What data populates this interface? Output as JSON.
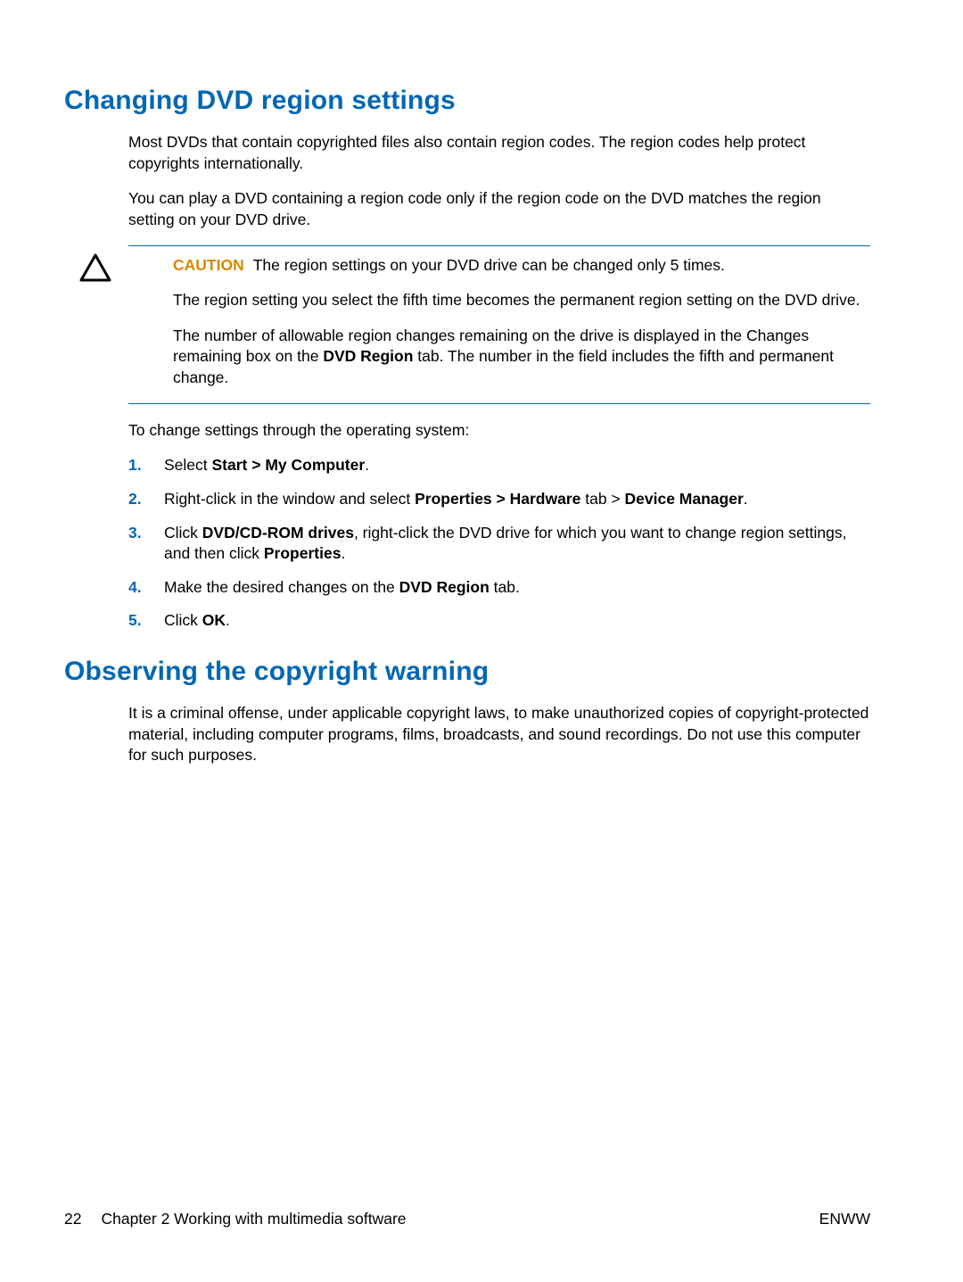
{
  "section1": {
    "heading": "Changing DVD region settings",
    "para1": "Most DVDs that contain copyrighted files also contain region codes. The region codes help protect copyrights internationally.",
    "para2": "You can play a DVD containing a region code only if the region code on the DVD matches the region setting on your DVD drive.",
    "caution": {
      "label": "CAUTION",
      "p1_tail": "The region settings on your DVD drive can be changed only 5 times.",
      "p2": "The region setting you select the fifth time becomes the permanent region setting on the DVD drive.",
      "p3_pre": "The number of allowable region changes remaining on the drive is displayed in the Changes remaining box on the ",
      "p3_bold": "DVD Region",
      "p3_post": " tab. The number in the field includes the fifth and permanent change."
    },
    "para3": "To change settings through the operating system:",
    "steps": {
      "s1_pre": "Select ",
      "s1_b": "Start > My Computer",
      "s1_post": ".",
      "s2_pre": "Right-click in the window and select ",
      "s2_b1": "Properties > Hardware",
      "s2_mid": " tab > ",
      "s2_b2": "Device Manager",
      "s2_post": ".",
      "s3_pre": "Click ",
      "s3_b1": "DVD/CD-ROM drives",
      "s3_mid": ", right-click the DVD drive for which you want to change region settings, and then click ",
      "s3_b2": "Properties",
      "s3_post": ".",
      "s4_pre": "Make the desired changes on the ",
      "s4_b": "DVD Region",
      "s4_post": " tab.",
      "s5_pre": "Click ",
      "s5_b": "OK",
      "s5_post": "."
    }
  },
  "section2": {
    "heading": "Observing the copyright warning",
    "para1": "It is a criminal offense, under applicable copyright laws, to make unauthorized copies of copyright-protected material, including computer programs, films, broadcasts, and sound recordings. Do not use this computer for such purposes."
  },
  "footer": {
    "page_number": "22",
    "chapter": "Chapter 2   Working with multimedia software",
    "right": "ENWW"
  }
}
